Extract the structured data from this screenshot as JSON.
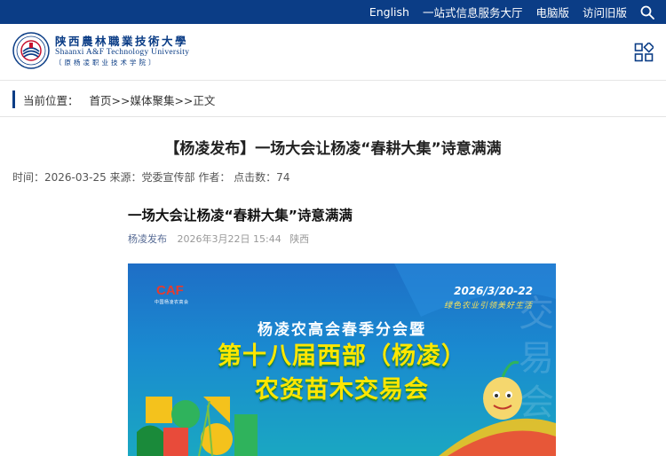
{
  "topbar": {
    "links": [
      "English",
      "一站式信息服务大厅",
      "电脑版",
      "访问旧版"
    ],
    "bg_color": "#0b3d86"
  },
  "header": {
    "logo_cn": "陕西農林職業技術大學",
    "logo_en": "Shaanxi A&F Technology University",
    "logo_old": "〔原杨凌职业技术学院〕"
  },
  "breadcrumb": {
    "label": "当前位置：",
    "path": "首页>>媒体聚集>>正文"
  },
  "article": {
    "title": "【杨凌发布】一场大会让杨凌“春耕大集”诗意满满",
    "meta": "时间：2026-03-25 来源：党委宣传部 作者：  点击数：74",
    "inner_title": "一场大会让杨凌“春耕大集”诗意满满",
    "inner_source": "杨凌发布",
    "inner_date": "2026年3月22日 15:44",
    "inner_region": "陕西"
  },
  "poster": {
    "logo": "CAF",
    "logo_sub": "中国杨凌农高会",
    "dates": "2026/3/20-22",
    "slogan": "绿色农业引领美好生活",
    "line1": "杨凌农高会春季分会暨",
    "line2": "第十八届西部（杨凌）",
    "line3": "农资苗木交易会"
  }
}
